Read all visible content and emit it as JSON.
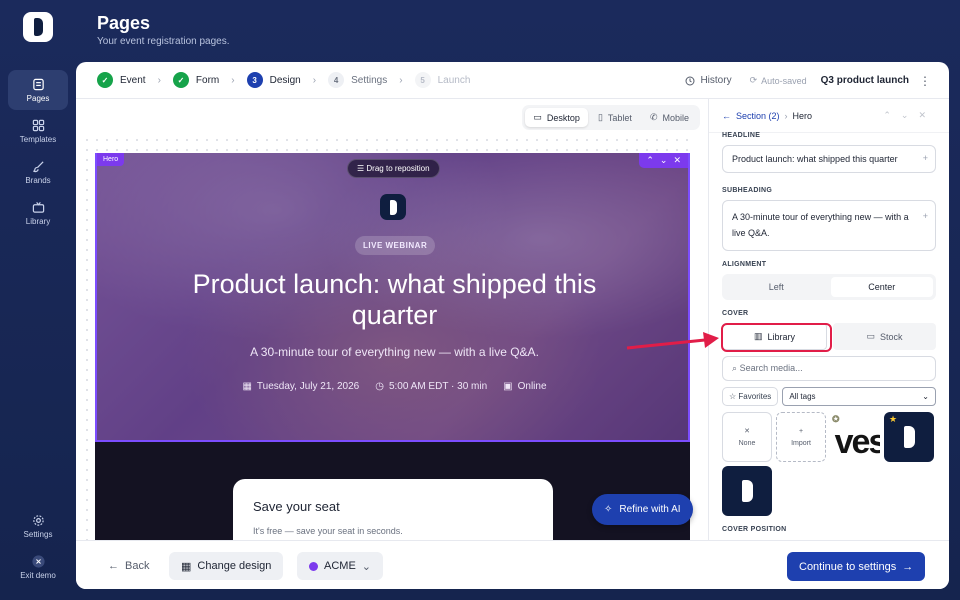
{
  "app": {
    "title": "Pages",
    "subtitle": "Your event registration pages."
  },
  "nav": {
    "items": [
      {
        "label": "Pages",
        "icon": "pages-icon"
      },
      {
        "label": "Templates",
        "icon": "templates-icon"
      },
      {
        "label": "Brands",
        "icon": "brush-icon"
      },
      {
        "label": "Library",
        "icon": "tv-icon"
      }
    ],
    "bottom": [
      {
        "label": "Settings",
        "icon": "gear-icon"
      },
      {
        "label": "Exit demo",
        "icon": "exit-icon"
      }
    ]
  },
  "steps": [
    {
      "label": "Event",
      "n": "✓"
    },
    {
      "label": "Form",
      "n": "✓"
    },
    {
      "label": "Design",
      "n": "3"
    },
    {
      "label": "Settings",
      "n": "4"
    },
    {
      "label": "Launch",
      "n": "5"
    }
  ],
  "topright": {
    "history": "History",
    "autosaved": "Auto-saved",
    "event_name": "Q3 product launch"
  },
  "devices": {
    "desktop": "Desktop",
    "tablet": "Tablet",
    "mobile": "Mobile"
  },
  "hero": {
    "tag": "Hero",
    "drag": "Drag to reposition",
    "badge": "LIVE WEBINAR",
    "headline": "Product launch: what shipped this quarter",
    "subheading": "A 30-minute tour of everything new — with a live Q&A.",
    "date": "Tuesday, July 21, 2026",
    "time": "5:00 AM EDT · 30 min",
    "location": "Online"
  },
  "seat": {
    "title": "Save your seat",
    "text": "It's free — save your seat in seconds."
  },
  "refine": "Refine with AI",
  "footer": {
    "back": "Back",
    "change": "Change design",
    "brand": "ACME",
    "continue": "Continue to settings"
  },
  "panel": {
    "crumb_section": "Section (2)",
    "crumb_current": "Hero",
    "headline_label": "HEADLINE",
    "headline_value": "Product launch: what shipped this quarter",
    "sub_label": "SUBHEADING",
    "sub_value": "A 30-minute tour of everything new — with a live Q&A.",
    "align_label": "ALIGNMENT",
    "align_left": "Left",
    "align_center": "Center",
    "cover_label": "COVER",
    "library": "Library",
    "stock": "Stock",
    "search_placeholder": "Search media...",
    "favorites": "Favorites",
    "all_tags": "All tags",
    "none": "None",
    "import": "Import",
    "cover_pos_label": "COVER POSITION"
  },
  "colors": {
    "accent": "#1e40af",
    "hero_outline": "#7c3aed",
    "highlight": "#e11d48"
  }
}
